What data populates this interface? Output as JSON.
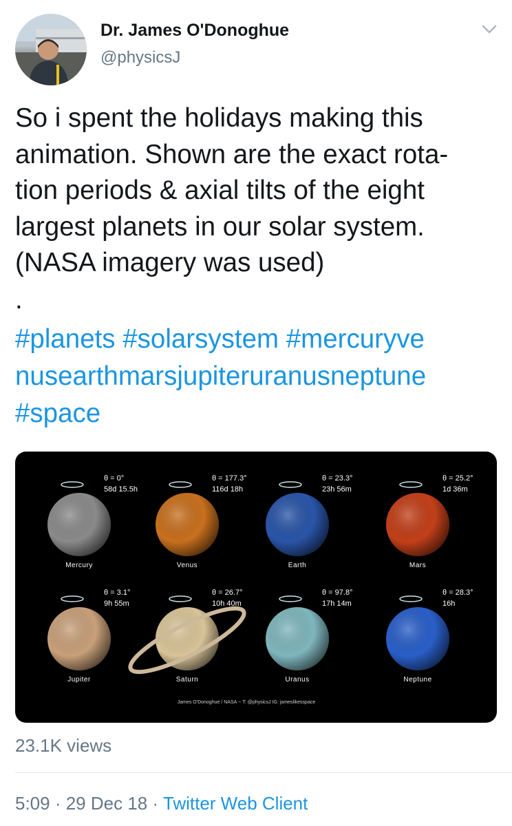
{
  "tweet": {
    "author_name": "Dr. James O'Donoghue",
    "author_handle": "@physicsJ",
    "text": "So i spent the holidays making this\nanimation. Shown are the exact rota-\ntion periods & axial tilts of the eight\nlargest planets in our solar system.\n(NASA imagery was used)",
    "separator": ".",
    "hashtags": [
      "#planets",
      "#solarsystem",
      "#mercuryve\nnusearthmarsjupiteruranusneptune",
      "#space"
    ],
    "views": "23.1K views",
    "time": "5:09",
    "date": "29 Dec 18",
    "client": "Twitter Web Client",
    "meta_sep": " · "
  },
  "media": {
    "planets": [
      {
        "name": "Mercury",
        "tilt": "θ = 0°",
        "period": "58d 15.5h",
        "color": "#8a8a8a"
      },
      {
        "name": "Venus",
        "tilt": "θ = 177.3°",
        "period": "116d 18h",
        "color": "#c8701e"
      },
      {
        "name": "Earth",
        "tilt": "θ = 23.3°",
        "period": "23h 56m",
        "color": "#2a55a8"
      },
      {
        "name": "Mars",
        "tilt": "θ = 25.2°",
        "period": "1d 36m",
        "color": "#c2401a"
      },
      {
        "name": "Jupiter",
        "tilt": "θ = 3.1°",
        "period": "9h 55m",
        "color": "#c8a07a"
      },
      {
        "name": "Saturn",
        "tilt": "θ = 26.7°",
        "period": "10h 40m",
        "color": "#d8c498"
      },
      {
        "name": "Uranus",
        "tilt": "θ = 97.8°",
        "period": "17h 14m",
        "color": "#7fb6bd"
      },
      {
        "name": "Neptune",
        "tilt": "θ = 28.3°",
        "period": "16h",
        "color": "#2a5fc8"
      }
    ],
    "credit": "James O'Donoghue / NASA  --  T: @physicsJ  IG: jameslikesspace"
  }
}
